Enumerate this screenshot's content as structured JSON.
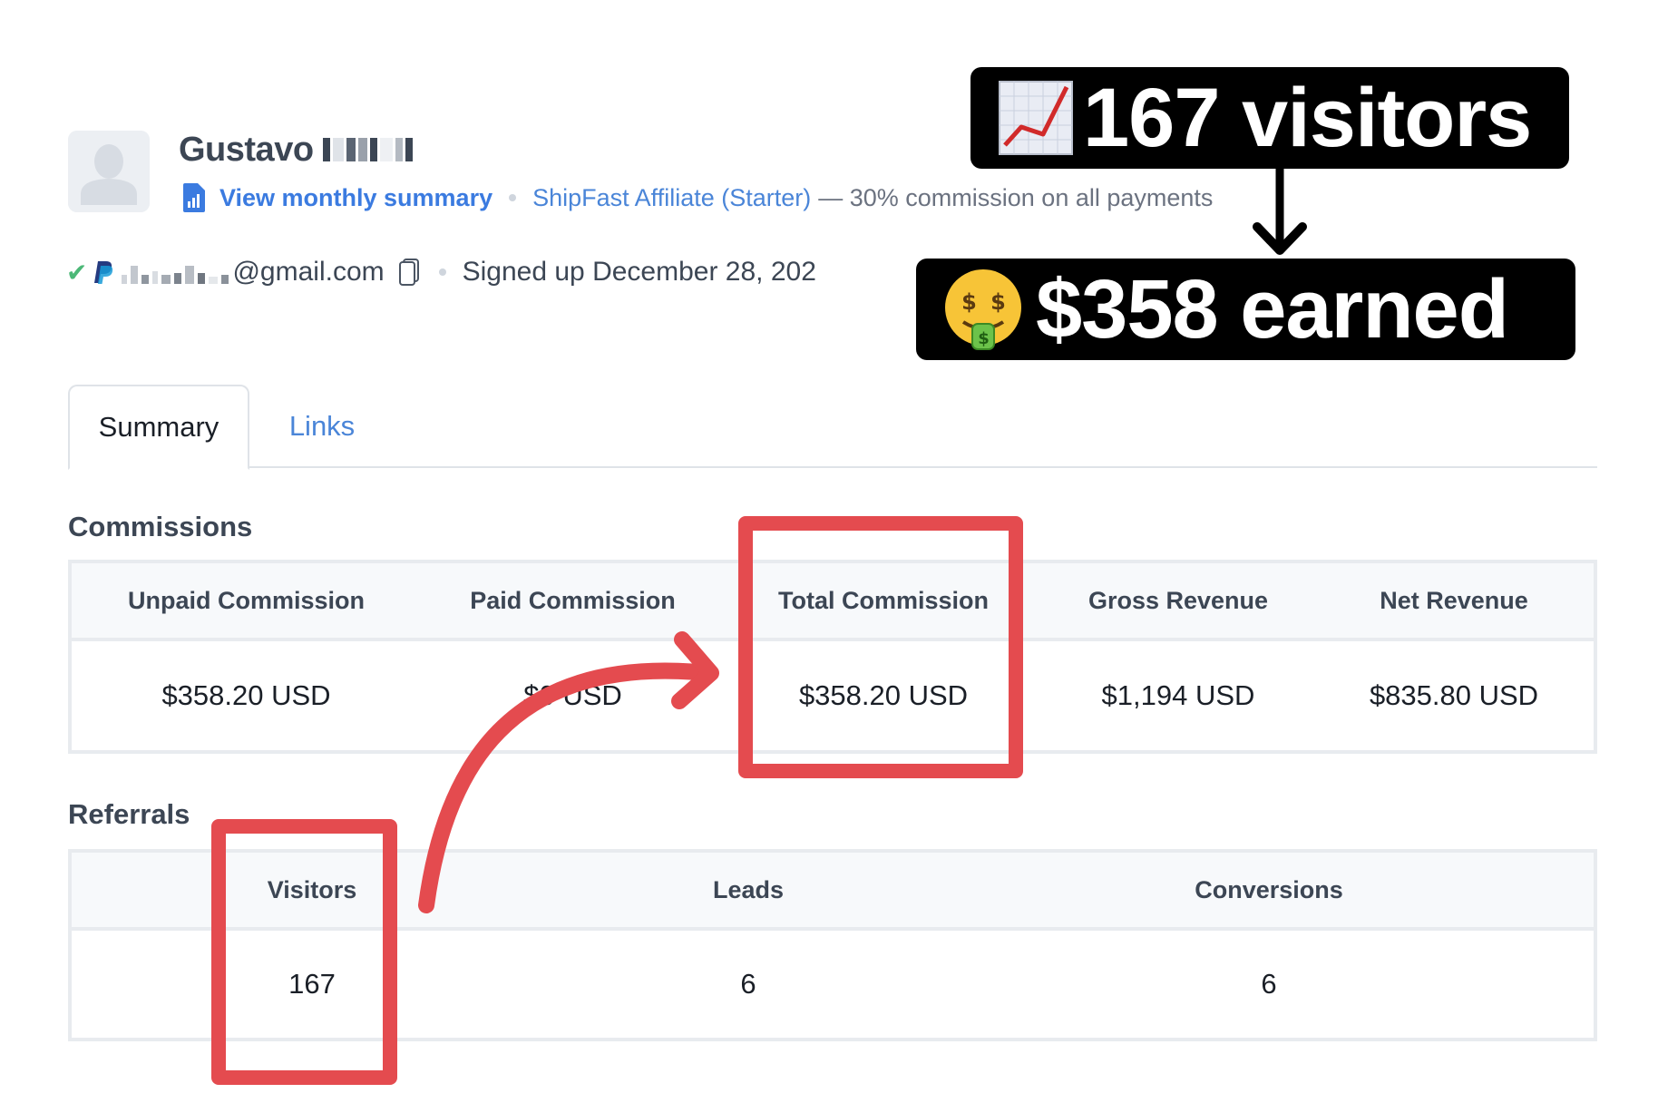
{
  "profile": {
    "first_name": "Gustavo",
    "last_name_redacted": true,
    "monthly_summary_link": "View monthly summary",
    "program_link": "ShipFast Affiliate (Starter)",
    "program_terms": "— 30% commission on all payments",
    "email_domain": "@gmail.com",
    "email_local_redacted": true,
    "payout_verified": true,
    "payout_method": "paypal",
    "signed_up": "Signed up December 28, 202"
  },
  "tabs": [
    {
      "label": "Summary",
      "active": true
    },
    {
      "label": "Links",
      "active": false
    }
  ],
  "commissions": {
    "title": "Commissions",
    "columns": [
      "Unpaid Commission",
      "Paid Commission",
      "Total Commission",
      "Gross Revenue",
      "Net Revenue"
    ],
    "values": [
      "$358.20 USD",
      "$0 USD",
      "$358.20 USD",
      "$1,194 USD",
      "$835.80 USD"
    ]
  },
  "referrals": {
    "title": "Referrals",
    "columns": [
      "Visitors",
      "Leads",
      "Conversions"
    ],
    "values": [
      "167",
      "6",
      "6"
    ]
  },
  "annotations": {
    "callout_visitors": {
      "emoji": "chart-increasing",
      "text": "167 visitors"
    },
    "callout_earned": {
      "emoji": "money-mouth-face",
      "text": "$358 earned"
    },
    "highlight_color": "#e44b4f",
    "callout_bg": "#000000"
  },
  "colors": {
    "link_blue": "#3b7be0",
    "heading": "#3c4654",
    "border": "#e8ebef",
    "header_bg": "#f7f9fb",
    "check_green": "#4cb877"
  }
}
